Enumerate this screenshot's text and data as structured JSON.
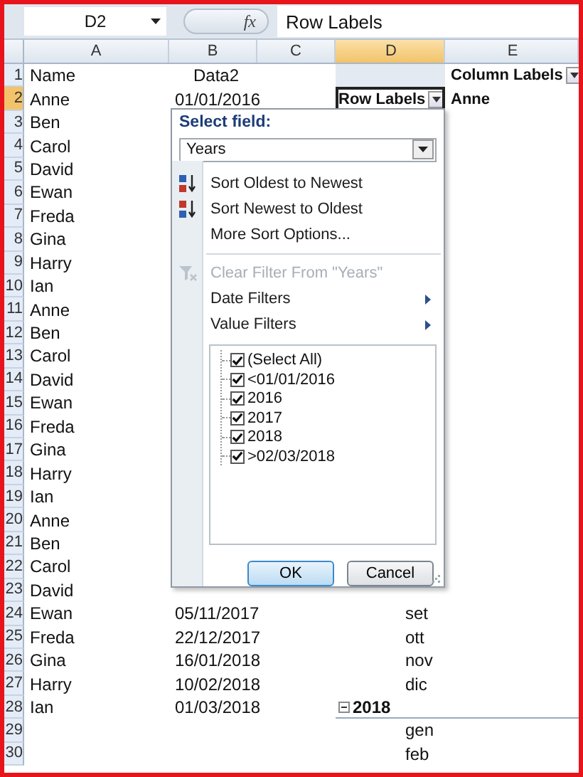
{
  "formula_bar": {
    "name_box": "D2",
    "fx": "fx",
    "formula": "Row Labels"
  },
  "columns": [
    {
      "label": "A",
      "selected": false
    },
    {
      "label": "B",
      "selected": false
    },
    {
      "label": "C",
      "selected": false
    },
    {
      "label": "D",
      "selected": true
    },
    {
      "label": "E",
      "selected": false
    }
  ],
  "rows": [
    {
      "number": "1",
      "selected": false,
      "a": "Name",
      "b": "Data2",
      "d": {
        "kind": "pivot-blank"
      },
      "e": {
        "kind": "header-button",
        "text": "Column Labels"
      }
    },
    {
      "number": "2",
      "selected": true,
      "a": "Anne",
      "b": "01/01/2016",
      "d": {
        "kind": "header-button",
        "text": "Row Labels"
      },
      "e": {
        "kind": "bold",
        "text": "Anne"
      }
    },
    {
      "number": "3",
      "selected": false,
      "a": "Ben"
    },
    {
      "number": "4",
      "selected": false,
      "a": "Carol"
    },
    {
      "number": "5",
      "selected": false,
      "a": "David"
    },
    {
      "number": "6",
      "selected": false,
      "a": "Ewan"
    },
    {
      "number": "7",
      "selected": false,
      "a": "Freda"
    },
    {
      "number": "8",
      "selected": false,
      "a": "Gina"
    },
    {
      "number": "9",
      "selected": false,
      "a": "Harry"
    },
    {
      "number": "10",
      "selected": false,
      "a": "Ian"
    },
    {
      "number": "11",
      "selected": false,
      "a": "Anne"
    },
    {
      "number": "12",
      "selected": false,
      "a": "Ben"
    },
    {
      "number": "13",
      "selected": false,
      "a": "Carol"
    },
    {
      "number": "14",
      "selected": false,
      "a": "David"
    },
    {
      "number": "15",
      "selected": false,
      "a": "Ewan"
    },
    {
      "number": "16",
      "selected": false,
      "a": "Freda"
    },
    {
      "number": "17",
      "selected": false,
      "a": "Gina"
    },
    {
      "number": "18",
      "selected": false,
      "a": "Harry"
    },
    {
      "number": "19",
      "selected": false,
      "a": "Ian"
    },
    {
      "number": "20",
      "selected": false,
      "a": "Anne"
    },
    {
      "number": "21",
      "selected": false,
      "a": "Ben"
    },
    {
      "number": "22",
      "selected": false,
      "a": "Carol"
    },
    {
      "number": "23",
      "selected": false,
      "a": "David"
    },
    {
      "number": "24",
      "selected": false,
      "a": "Ewan",
      "b": "05/11/2017",
      "d": {
        "kind": "month",
        "text": "set"
      }
    },
    {
      "number": "25",
      "selected": false,
      "a": "Freda",
      "b": "22/12/2017",
      "d": {
        "kind": "month",
        "text": "ott"
      }
    },
    {
      "number": "26",
      "selected": false,
      "a": "Gina",
      "b": "16/01/2018",
      "d": {
        "kind": "month",
        "text": "nov"
      }
    },
    {
      "number": "27",
      "selected": false,
      "a": "Harry",
      "b": "10/02/2018",
      "d": {
        "kind": "month",
        "text": "dic"
      }
    },
    {
      "number": "28",
      "selected": false,
      "a": "Ian",
      "b": "01/03/2018",
      "d": {
        "kind": "group",
        "text": "2018"
      }
    },
    {
      "number": "29",
      "selected": false,
      "d": {
        "kind": "month",
        "text": "gen"
      }
    },
    {
      "number": "30",
      "selected": false,
      "d": {
        "kind": "month",
        "text": "feb"
      }
    }
  ],
  "filter_menu": {
    "title": "Select field:",
    "field": "Years",
    "items": [
      {
        "kind": "sort-asc",
        "label": "Sort Oldest to Newest",
        "disabled": false
      },
      {
        "kind": "sort-desc",
        "label": "Sort Newest to Oldest",
        "disabled": false
      },
      {
        "kind": "plain",
        "label": "More Sort Options...",
        "disabled": false
      },
      {
        "kind": "separator"
      },
      {
        "kind": "clear",
        "label": "Clear Filter From \"Years\"",
        "disabled": true
      },
      {
        "kind": "submenu",
        "label": "Date Filters",
        "disabled": false
      },
      {
        "kind": "submenu",
        "label": "Value Filters",
        "disabled": false
      }
    ],
    "values": [
      {
        "label": "(Select All)",
        "checked": true
      },
      {
        "label": "<01/01/2016",
        "checked": true
      },
      {
        "label": "2016",
        "checked": true
      },
      {
        "label": "2017",
        "checked": true
      },
      {
        "label": "2018",
        "checked": true
      },
      {
        "label": ">02/03/2018",
        "checked": true
      }
    ],
    "buttons": [
      "OK",
      "Cancel"
    ]
  }
}
